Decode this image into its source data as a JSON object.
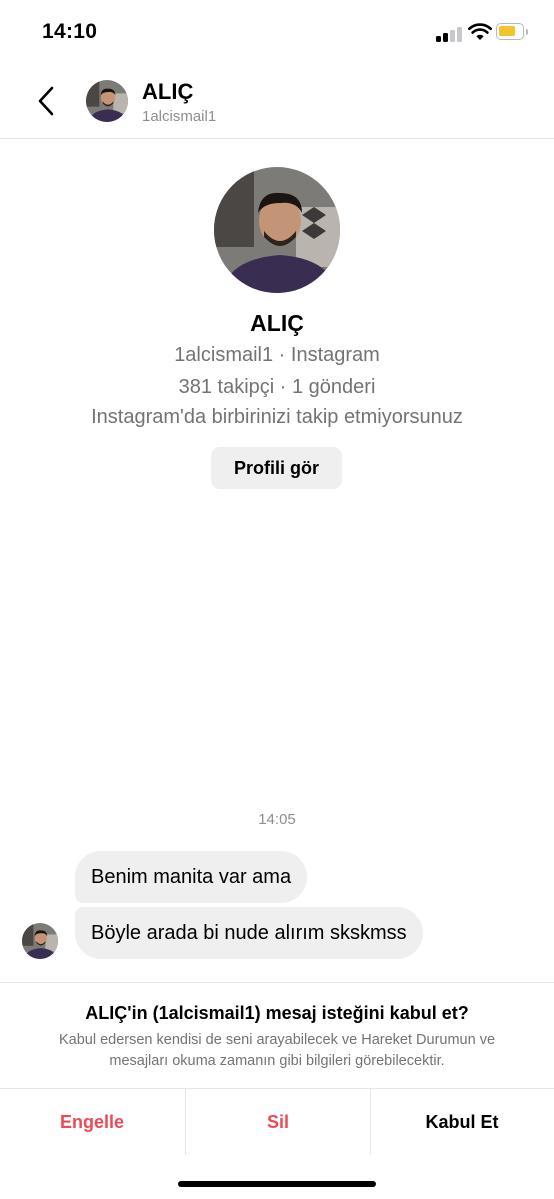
{
  "status_bar": {
    "time": "14:10"
  },
  "header": {
    "name": "ALIÇ",
    "username": "1alcismail1"
  },
  "profile": {
    "name": "ALIÇ",
    "subtitle": "1alcismail1 · Instagram",
    "stats": "381 takipçi · 1 gönderi",
    "follow_status": "Instagram'da birbirinizi takip etmiyorsunuz",
    "view_profile_label": "Profili gör"
  },
  "messages": {
    "timestamp": "14:05",
    "items": [
      {
        "text": "Benim manita var ama"
      },
      {
        "text": "Böyle arada bi nude alırım skskmss"
      }
    ]
  },
  "request": {
    "title": "ALIÇ'in (1alcismail1) mesaj isteğini kabul et?",
    "description": "Kabul edersen kendisi de seni arayabilecek ve Hareket Durumun ve mesajları okuma zamanın gibi bilgileri görebilecektir."
  },
  "actions": {
    "block": "Engelle",
    "delete": "Sil",
    "accept": "Kabul Et"
  },
  "colors": {
    "danger": "#ed4956",
    "bubble": "#efefef",
    "muted": "#737373"
  },
  "icons": [
    "back-chevron-icon",
    "signal-icon",
    "wifi-icon",
    "battery-icon"
  ]
}
